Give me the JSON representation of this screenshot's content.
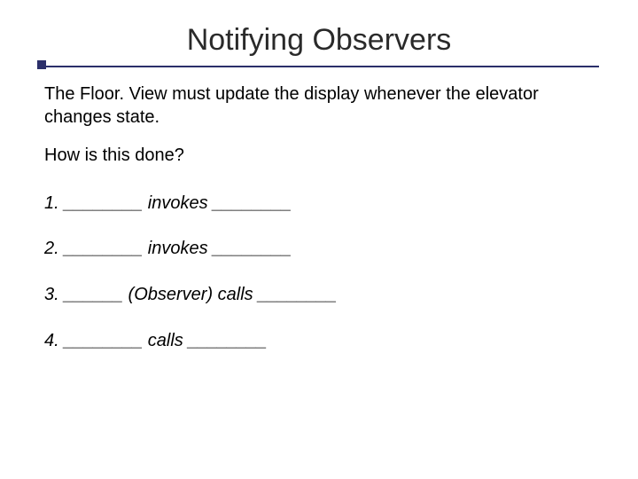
{
  "title": "Notifying Observers",
  "intro": "The Floor. View must update the display whenever the elevator changes state.",
  "question": "How is this done?",
  "items": [
    "1. ________ invokes ________",
    "2. ________ invokes ________",
    "3. ______ (Observer) calls ________",
    "4. ________ calls ________"
  ]
}
